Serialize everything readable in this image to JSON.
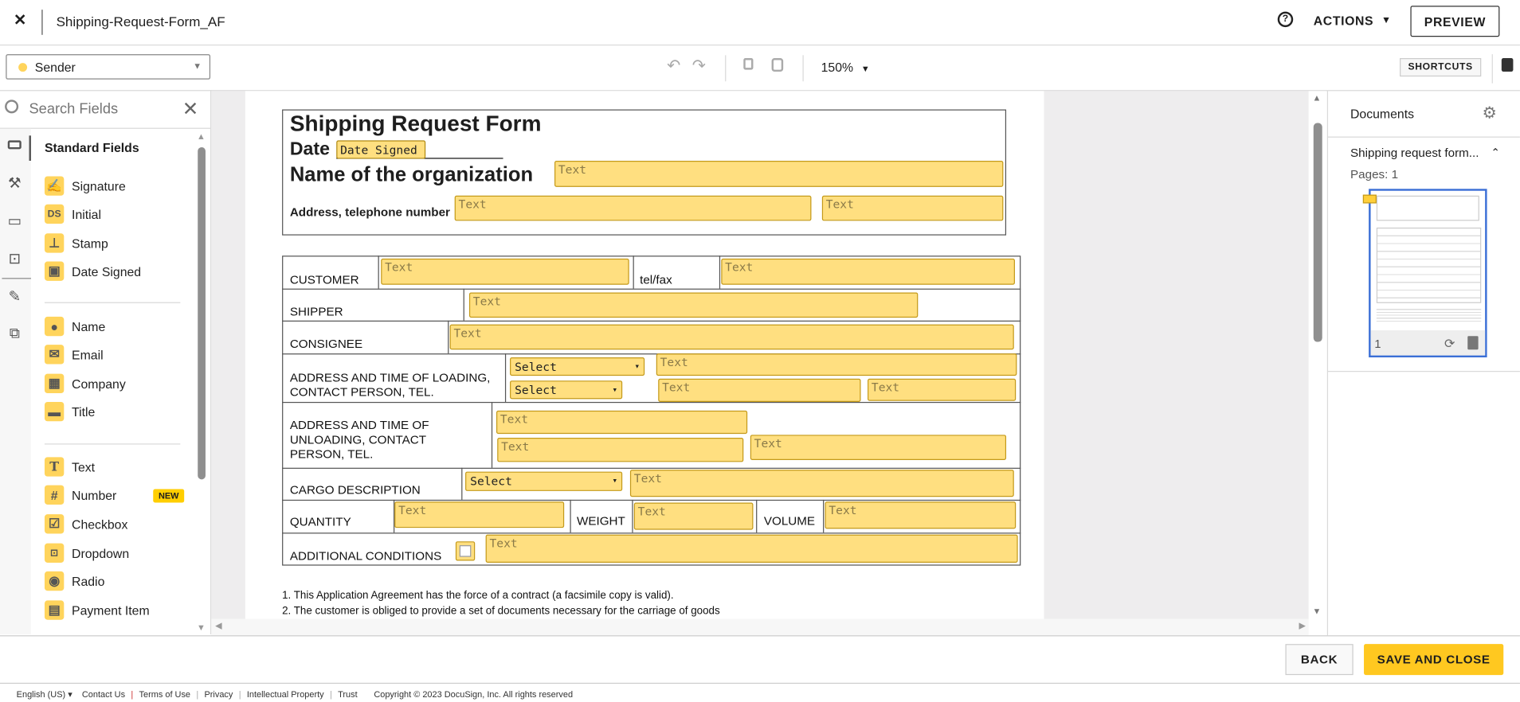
{
  "header": {
    "title": "Shipping-Request-Form_AF",
    "actions_label": "ACTIONS",
    "preview_label": "PREVIEW"
  },
  "toolbar": {
    "recipient": "Sender",
    "recipient_color": "#ffd45c",
    "zoom": "150%",
    "shortcuts_label": "SHORTCUTS"
  },
  "sidebar": {
    "search_placeholder": "Search Fields",
    "section_title": "Standard Fields",
    "items": [
      {
        "label": "Signature",
        "icon": "signature-icon"
      },
      {
        "label": "Initial",
        "icon": "initial-icon",
        "glyph": "DS"
      },
      {
        "label": "Stamp",
        "icon": "stamp-icon"
      },
      {
        "label": "Date Signed",
        "icon": "calendar-icon"
      },
      {
        "label": "Name",
        "icon": "person-icon"
      },
      {
        "label": "Email",
        "icon": "envelope-icon"
      },
      {
        "label": "Company",
        "icon": "building-icon"
      },
      {
        "label": "Title",
        "icon": "briefcase-icon"
      },
      {
        "label": "Text",
        "icon": "text-icon",
        "glyph": "T"
      },
      {
        "label": "Number",
        "icon": "hash-icon",
        "glyph": "#",
        "badge": "NEW"
      },
      {
        "label": "Checkbox",
        "icon": "checkbox-icon"
      },
      {
        "label": "Dropdown",
        "icon": "dropdown-icon"
      },
      {
        "label": "Radio",
        "icon": "radio-icon"
      },
      {
        "label": "Payment Item",
        "icon": "payment-icon"
      }
    ]
  },
  "document": {
    "title": "Shipping Request Form",
    "date_label": "Date",
    "org_label": "Name of the organization",
    "address_label": "Address, telephone number",
    "date_signed_field": "Date Signed",
    "text_field": "Text",
    "select_field": "Select",
    "rows": {
      "customer": "CUSTOMER",
      "telfax": "tel/fax",
      "shipper": "SHIPPER",
      "consignee": "CONSIGNEE",
      "loading": "ADDRESS AND TIME OF LOADING, CONTACT PERSON, TEL.",
      "unloading": "ADDRESS AND TIME OF UNLOADING, CONTACT PERSON, TEL.",
      "cargo": "CARGO DESCRIPTION",
      "quantity": "QUANTITY",
      "weight": "WEIGHT",
      "volume": "VOLUME",
      "additional": "ADDITIONAL CONDITIONS"
    },
    "notes": [
      "1. This Application Agreement has the force of a contract (a facsimile copy is valid).",
      "2. The customer is obliged to provide a set of documents necessary for the carriage of goods"
    ]
  },
  "documents_panel": {
    "title": "Documents",
    "doc_name": "Shipping request form...",
    "pages": "Pages: 1",
    "page_number": "1"
  },
  "bottom": {
    "back_label": "BACK",
    "save_label": "SAVE AND CLOSE"
  },
  "footer": {
    "language": "English (US)",
    "links": [
      "Contact Us",
      "Terms of Use",
      "Privacy",
      "Intellectual Property",
      "Trust"
    ],
    "copyright": "Copyright © 2023 DocuSign, Inc. All rights reserved"
  }
}
